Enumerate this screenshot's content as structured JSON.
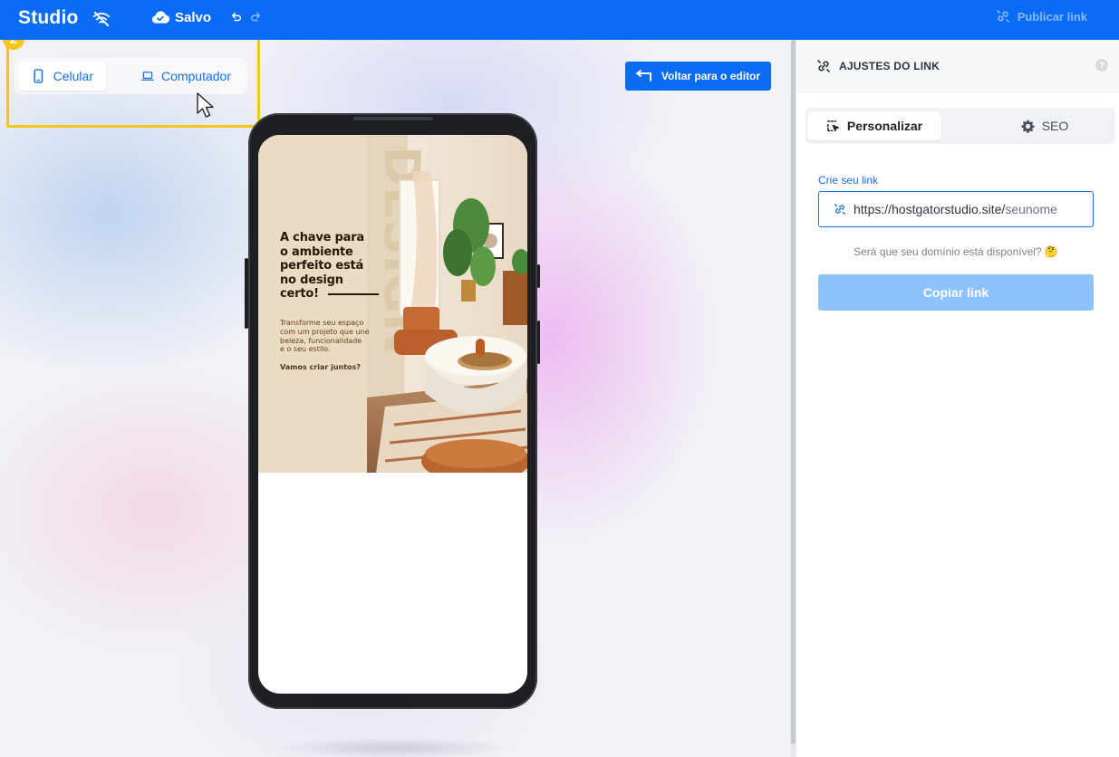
{
  "topbar": {
    "logo": "Studio",
    "saved_label": "Salvo",
    "publish_label": "Publicar link"
  },
  "canvas": {
    "device_switch": {
      "mobile_label": "Celular",
      "desktop_label": "Computador",
      "selected": "Celular"
    },
    "step_badge": "2",
    "back_button_label": "Voltar para o editor",
    "preview": {
      "title_lines": [
        "A chave para",
        "o ambiente",
        "perfeito está",
        "no design",
        "certo!"
      ],
      "body_lines": [
        "Transforme seu espaço",
        "com um projeto que une",
        "beleza, funcionalidade",
        "e o seu estilo."
      ],
      "cta": "Vamos criar juntos?"
    }
  },
  "panel": {
    "title": "AJUSTES DO LINK",
    "tabs": [
      {
        "label": "Personalizar",
        "active": true
      },
      {
        "label": "SEO",
        "active": false
      }
    ],
    "link_field": {
      "label": "Crie seu link",
      "prefix": "https://hostgatorstudio.site/",
      "placeholder": "seunome"
    },
    "hint": "Será que seu domínio está disponível? 🤔",
    "copy_button_label": "Copiar link"
  },
  "colors": {
    "primary": "#0a6cf5",
    "highlight": "#f5c518",
    "copy_button_disabled": "#8ec2fb",
    "hero_background": "#eadcc2",
    "hero_title": "#2a1608"
  }
}
